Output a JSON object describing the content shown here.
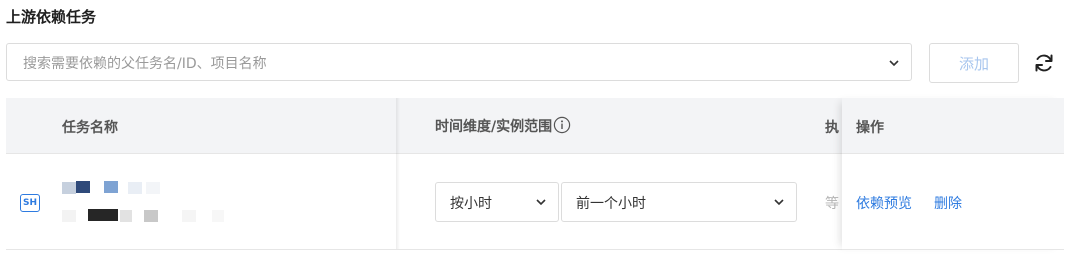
{
  "section": {
    "title": "上游依赖任务"
  },
  "search": {
    "placeholder": "搜索需要依赖的父任务名/ID、项目名称",
    "value": ""
  },
  "toolbar": {
    "add_label": "添加"
  },
  "table": {
    "headers": {
      "task_name": "任务名称",
      "time_scope": "时间维度/实例范围",
      "exec": "执",
      "actions": "操作"
    },
    "rows": [
      {
        "type_badge": "SH",
        "time_unit": "按小时",
        "instance_range": "前一个小时",
        "truncated": "等",
        "actions": {
          "preview": "依赖预览",
          "delete": "删除"
        }
      }
    ]
  },
  "colors": {
    "accent": "#2e7be0",
    "disabled_text": "#a8c6ee",
    "header_bg": "#f3f4f6"
  }
}
